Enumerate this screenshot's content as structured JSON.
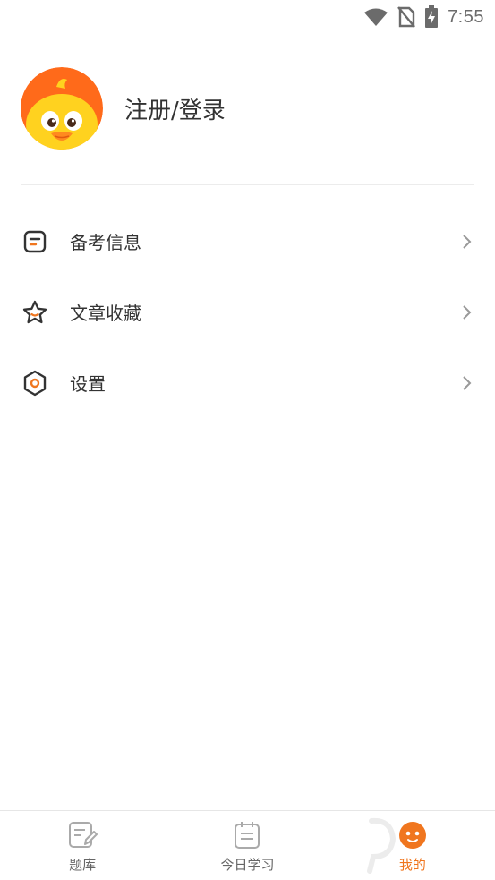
{
  "status_bar": {
    "time": "7:55",
    "icons": [
      "wifi-icon",
      "no-sim-icon",
      "battery-charging-icon"
    ]
  },
  "profile": {
    "login_label": "注册/登录",
    "avatar_icon": "duck-avatar-icon"
  },
  "menu": {
    "items": [
      {
        "label": "备考信息",
        "icon": "note-icon"
      },
      {
        "label": "文章收藏",
        "icon": "star-icon"
      },
      {
        "label": "设置",
        "icon": "settings-hexagon-icon"
      }
    ]
  },
  "bottom_nav": {
    "tabs": [
      {
        "label": "题库",
        "icon": "edit-sheet-icon",
        "active": false
      },
      {
        "label": "今日学习",
        "icon": "calendar-list-icon",
        "active": false
      },
      {
        "label": "我的",
        "icon": "profile-face-icon",
        "active": true
      }
    ]
  },
  "colors": {
    "accent": "#f0761f",
    "avatar_orange": "#ff6a1a",
    "text_primary": "#333333",
    "text_secondary": "#666666",
    "divider": "#ececec"
  }
}
